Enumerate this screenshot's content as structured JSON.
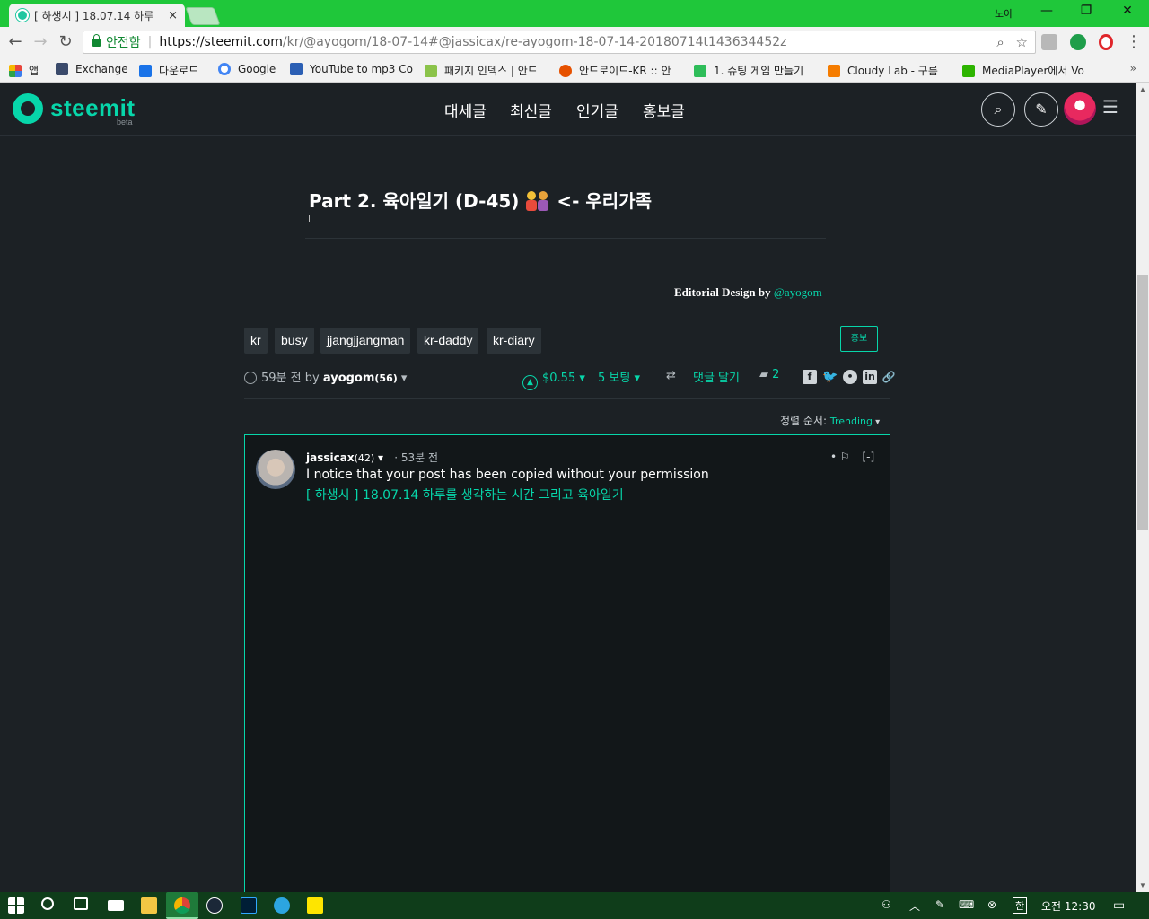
{
  "browser": {
    "tab_title": "[ 하생시 ] 18.07.14 하루",
    "tab_close": "×",
    "profile_name": "노아",
    "window_controls": {
      "minimize": "—",
      "restore": "❐",
      "close": "✕"
    },
    "nav": {
      "back": "←",
      "forward": "→",
      "reload": "↻"
    },
    "secure_label": "안전함",
    "url_host": "https://steemit.com",
    "url_path": "/kr/@ayogom/18-07-14#@jassicax/re-ayogom-18-07-14-20180714t143634452z",
    "omnibox_icons": {
      "zoom": "⌕",
      "star": "☆"
    },
    "more_menu": "⋮"
  },
  "bookmarks": [
    {
      "label": "앱",
      "icon": "apps-grid-icon",
      "color": "#e8453c"
    },
    {
      "label": "Exchange",
      "icon": "exchange-icon",
      "color": "#3a4a6b"
    },
    {
      "label": "다운로드",
      "icon": "download-icon",
      "color": "#1a73e8"
    },
    {
      "label": "Google",
      "icon": "google-icon",
      "color": "#4285f4"
    },
    {
      "label": "YouTube to mp3 Co",
      "icon": "mp3-icon",
      "color": "#2b5fb4"
    },
    {
      "label": "패키지 인덱스 | 안드",
      "icon": "android-icon",
      "color": "#8bc34a"
    },
    {
      "label": "안드로이드-KR :: 안",
      "icon": "android-kr-icon",
      "color": "#e65100"
    },
    {
      "label": "1. 슈팅 게임 만들기",
      "icon": "book-icon",
      "color": "#2ebd59"
    },
    {
      "label": "Cloudy Lab - 구름",
      "icon": "blogger-icon",
      "color": "#f57c00"
    },
    {
      "label": "MediaPlayer에서 Vo",
      "icon": "blog-icon",
      "color": "#2db400"
    }
  ],
  "bookmarks_more": "»",
  "site": {
    "logo": "steemit",
    "logo_sub": "beta",
    "nav": [
      "대세글",
      "최신글",
      "인기글",
      "홍보글"
    ],
    "search_icon": "⌕",
    "edit_icon": "✎",
    "menu_icon": "☰"
  },
  "post": {
    "title_before": "Part 2. 육아일기 (D-45)",
    "title_after": "<- 우리가족",
    "editorial_label": "Editorial Design by",
    "editorial_author": "@ayogom",
    "tags": [
      "kr",
      "busy",
      "jjangjjangman",
      "kr-daddy",
      "kr-diary"
    ],
    "promote_label": "홍보",
    "time_ago": "59분 전",
    "by": "by",
    "author": "ayogom",
    "author_rep": "(56)",
    "payout": "$0.55",
    "votes": "5 보팅",
    "reply_label": "댓글 달기",
    "comment_count": "2",
    "share_icons": [
      "facebook-icon",
      "twitter-icon",
      "reddit-icon",
      "linkedin-icon",
      "link-icon"
    ],
    "sort_label": "정렬 순서:",
    "sort_value": "Trending"
  },
  "comment": {
    "author": "jassicax",
    "author_rep": "(42)",
    "time_ago": "53분 전",
    "body": "I notice that your post has been copied without your permission",
    "link_text": "[ 하생시 ] 18.07.14 하루를 생각하는 시간 그리고 육아일기",
    "flag": "• ⚐",
    "collapse": "[-]"
  },
  "taskbar": {
    "ime": "한",
    "time": "오전 12:30",
    "apps": [
      "start-icon",
      "search-icon",
      "task-view-icon",
      "mail-icon",
      "explorer-icon",
      "chrome-icon",
      "steam-icon",
      "photoshop-icon",
      "telegram-icon",
      "kakaotalk-icon"
    ]
  }
}
